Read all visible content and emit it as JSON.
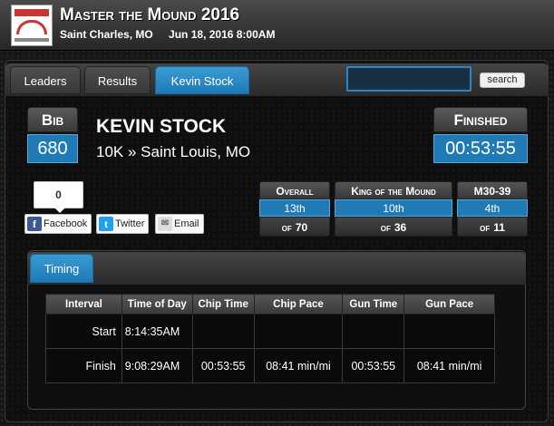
{
  "header": {
    "event_title": "Master the Mound 2016",
    "location": "Saint Charles, MO",
    "date": "Jun 18, 2016 8:00AM"
  },
  "tabs": [
    {
      "label": "Leaders"
    },
    {
      "label": "Results"
    },
    {
      "label": "Kevin Stock"
    }
  ],
  "search": {
    "value": "",
    "button_label": "search"
  },
  "runner": {
    "bib_label": "Bib",
    "bib": "680",
    "name": "KEVIN STOCK",
    "race_info": "10K » Saint Louis, MO",
    "finished_label": "Finished",
    "finish_time": "00:53:55"
  },
  "social": {
    "like_count": "0",
    "facebook": "Facebook",
    "twitter": "Twitter",
    "email": "Email"
  },
  "rankings": [
    {
      "label": "Overall",
      "place": "13th",
      "of_word": "of",
      "total": "70"
    },
    {
      "label": "King of the Mound",
      "place": "10th",
      "of_word": "of",
      "total": "36"
    },
    {
      "label": "M30-39",
      "place": "4th",
      "of_word": "of",
      "total": "11"
    }
  ],
  "timing": {
    "tab_label": "Timing",
    "columns": [
      "Interval",
      "Time of Day",
      "Chip Time",
      "Chip Pace",
      "Gun Time",
      "Gun Pace"
    ],
    "rows": [
      [
        "Start",
        "8:14:35AM",
        "",
        "",
        "",
        ""
      ],
      [
        "Finish",
        "9:08:29AM",
        "00:53:55",
        "08:41 min/mi",
        "00:53:55",
        "08:41 min/mi"
      ]
    ]
  },
  "colors": {
    "accent_blue": "#1f7ab6",
    "header_gray": "#3a3a3a"
  }
}
